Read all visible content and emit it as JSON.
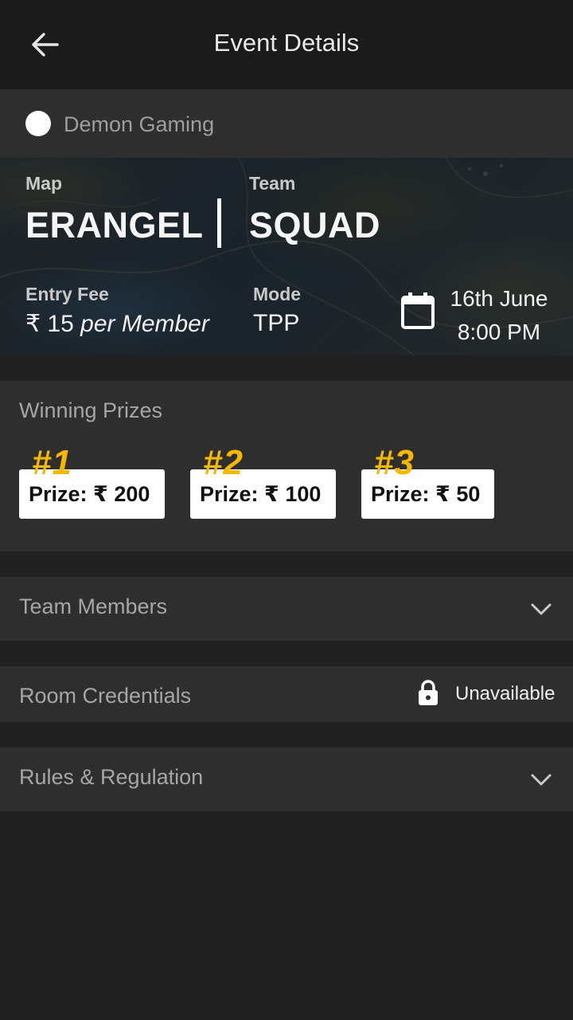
{
  "app_bar": {
    "title": "Event Details",
    "back_icon": "arrow-left-icon"
  },
  "organizer": {
    "name": "Demon Gaming"
  },
  "event": {
    "map_label": "Map",
    "map_value": "ERANGEL",
    "team_label": "Team",
    "team_value": "SQUAD",
    "entry_fee_label": "Entry Fee",
    "entry_fee_amount": "₹ 15",
    "entry_fee_unit": "per Member",
    "mode_label": "Mode",
    "mode_value": "TPP",
    "date": "16th June",
    "time": "8:00 PM",
    "calendar_icon": "calendar-icon"
  },
  "prizes": {
    "title": "Winning Prizes",
    "items": [
      {
        "rank": "#1",
        "label": "Prize: ₹  200"
      },
      {
        "rank": "#2",
        "label": "Prize: ₹  100"
      },
      {
        "rank": "#3",
        "label": "Prize: ₹  50"
      }
    ],
    "rank_color": "#f5b800"
  },
  "team_members": {
    "title": "Team Members",
    "icon": "chevron-down-icon"
  },
  "room_credentials": {
    "title": "Room Credentials",
    "status": "Unavailable",
    "icon": "lock-icon"
  },
  "rules": {
    "title": "Rules & Regulation",
    "icon": "chevron-down-icon"
  }
}
